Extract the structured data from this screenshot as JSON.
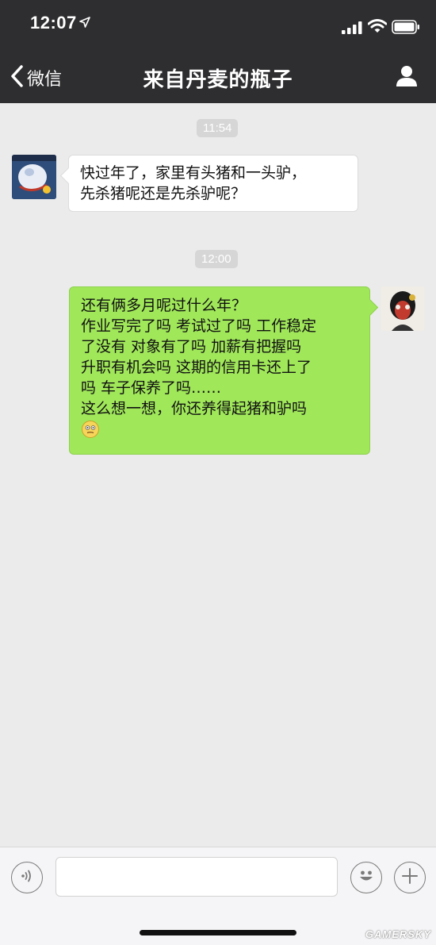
{
  "status_bar": {
    "time": "12:07"
  },
  "nav": {
    "back_label": "微信",
    "title": "来自丹麦的瓶子"
  },
  "messages": {
    "time1": "11:54",
    "incoming": {
      "lines": [
        "快过年了，家里有头猪和一头驴，",
        "先杀猪呢还是先杀驴呢？"
      ]
    },
    "time2": "12:00",
    "outgoing": {
      "lines": [
        "还有俩多月呢过什么年？",
        "作业写完了吗 考试过了吗 工作稳定",
        "了没有 对象有了吗 加薪有把握吗",
        "升职有机会吗 这期的信用卡还上了",
        "吗 车子保养了吗……",
        "这么想一想，你还养得起猪和驴吗"
      ],
      "emoji": "awkward-face"
    }
  },
  "input_bar": {
    "text_value": ""
  },
  "watermark": "GAMERSKY",
  "colors": {
    "nav_bg": "#2e2e30",
    "chat_bg": "#ebebeb",
    "outgoing_bubble": "#a0e75a",
    "incoming_bubble": "#ffffff"
  }
}
